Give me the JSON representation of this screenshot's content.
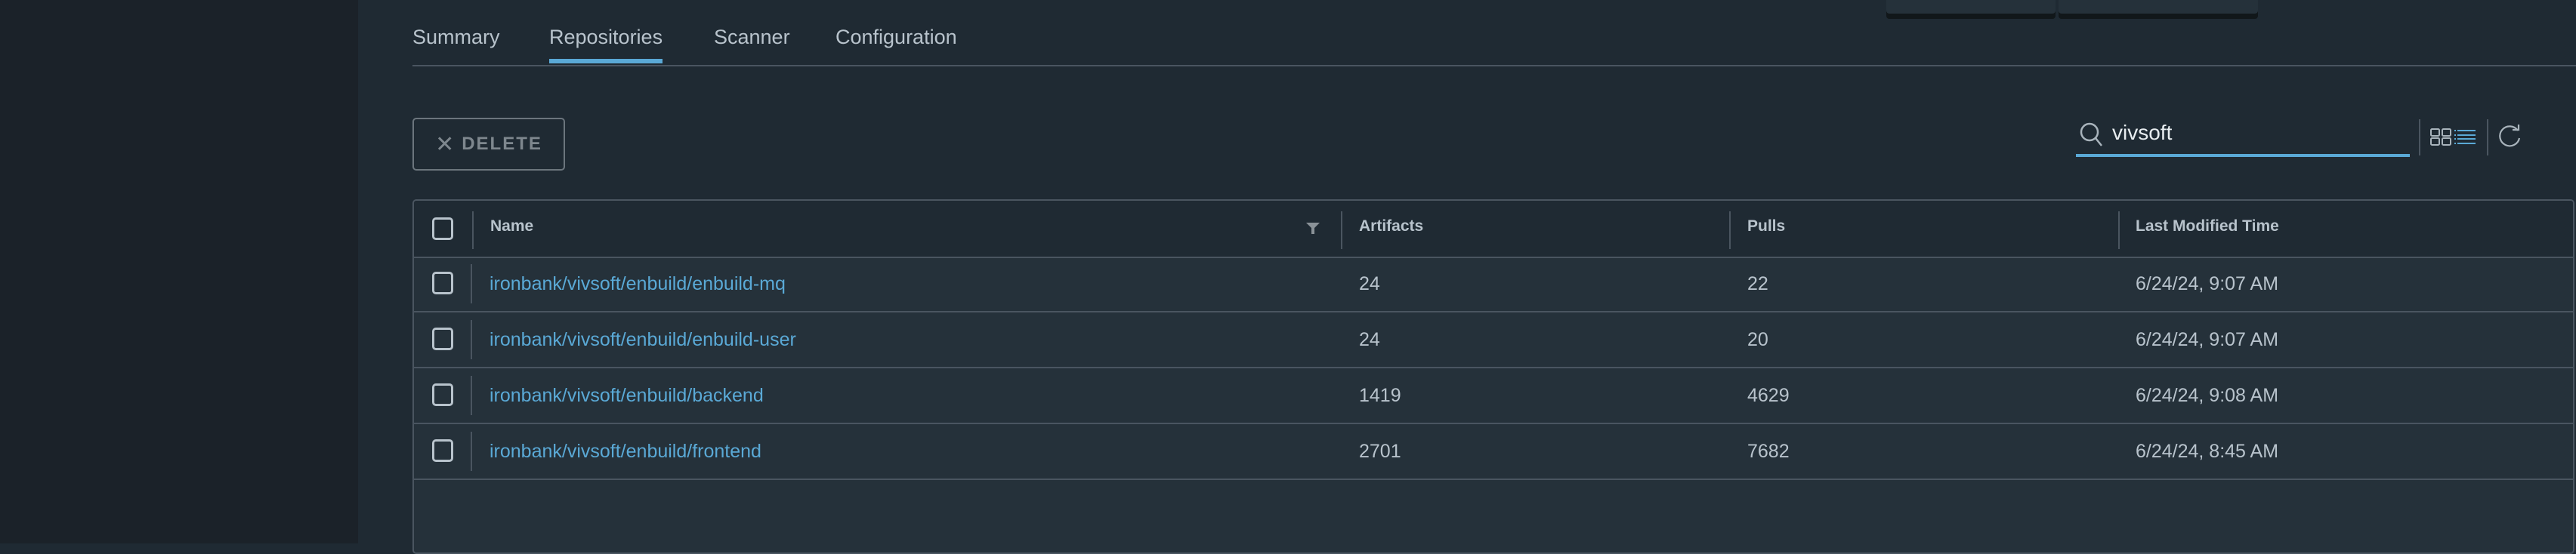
{
  "tabs": [
    {
      "label": "Summary",
      "active": false
    },
    {
      "label": "Repositories",
      "active": true
    },
    {
      "label": "Scanner",
      "active": false
    },
    {
      "label": "Configuration",
      "active": false
    }
  ],
  "toolbar": {
    "delete_icon": "close-icon",
    "delete_label": "DELETE"
  },
  "search": {
    "icon": "search-icon",
    "value": "vivsoft"
  },
  "view_toggle": {
    "icon": "grid-list-toggle-icon"
  },
  "refresh": {
    "icon": "refresh-icon"
  },
  "table": {
    "columns": [
      {
        "label": "Name",
        "filterable": true
      },
      {
        "label": "Artifacts"
      },
      {
        "label": "Pulls"
      },
      {
        "label": "Last Modified Time"
      }
    ],
    "rows": [
      {
        "name": "ironbank/vivsoft/enbuild/enbuild-mq",
        "artifacts": "24",
        "pulls": "22",
        "modified": "6/24/24, 9:07 AM"
      },
      {
        "name": "ironbank/vivsoft/enbuild/enbuild-user",
        "artifacts": "24",
        "pulls": "20",
        "modified": "6/24/24, 9:07 AM"
      },
      {
        "name": "ironbank/vivsoft/enbuild/backend",
        "artifacts": "1419",
        "pulls": "4629",
        "modified": "6/24/24, 9:08 AM"
      },
      {
        "name": "ironbank/vivsoft/enbuild/frontend",
        "artifacts": "2701",
        "pulls": "7682",
        "modified": "6/24/24, 8:45 AM"
      }
    ]
  },
  "colors": {
    "accent": "#5aa9d6",
    "background": "#1f2a33",
    "nav_background": "#1b2229",
    "row_background": "#25313a",
    "border": "#4a5560",
    "text": "#b8c3cc"
  }
}
